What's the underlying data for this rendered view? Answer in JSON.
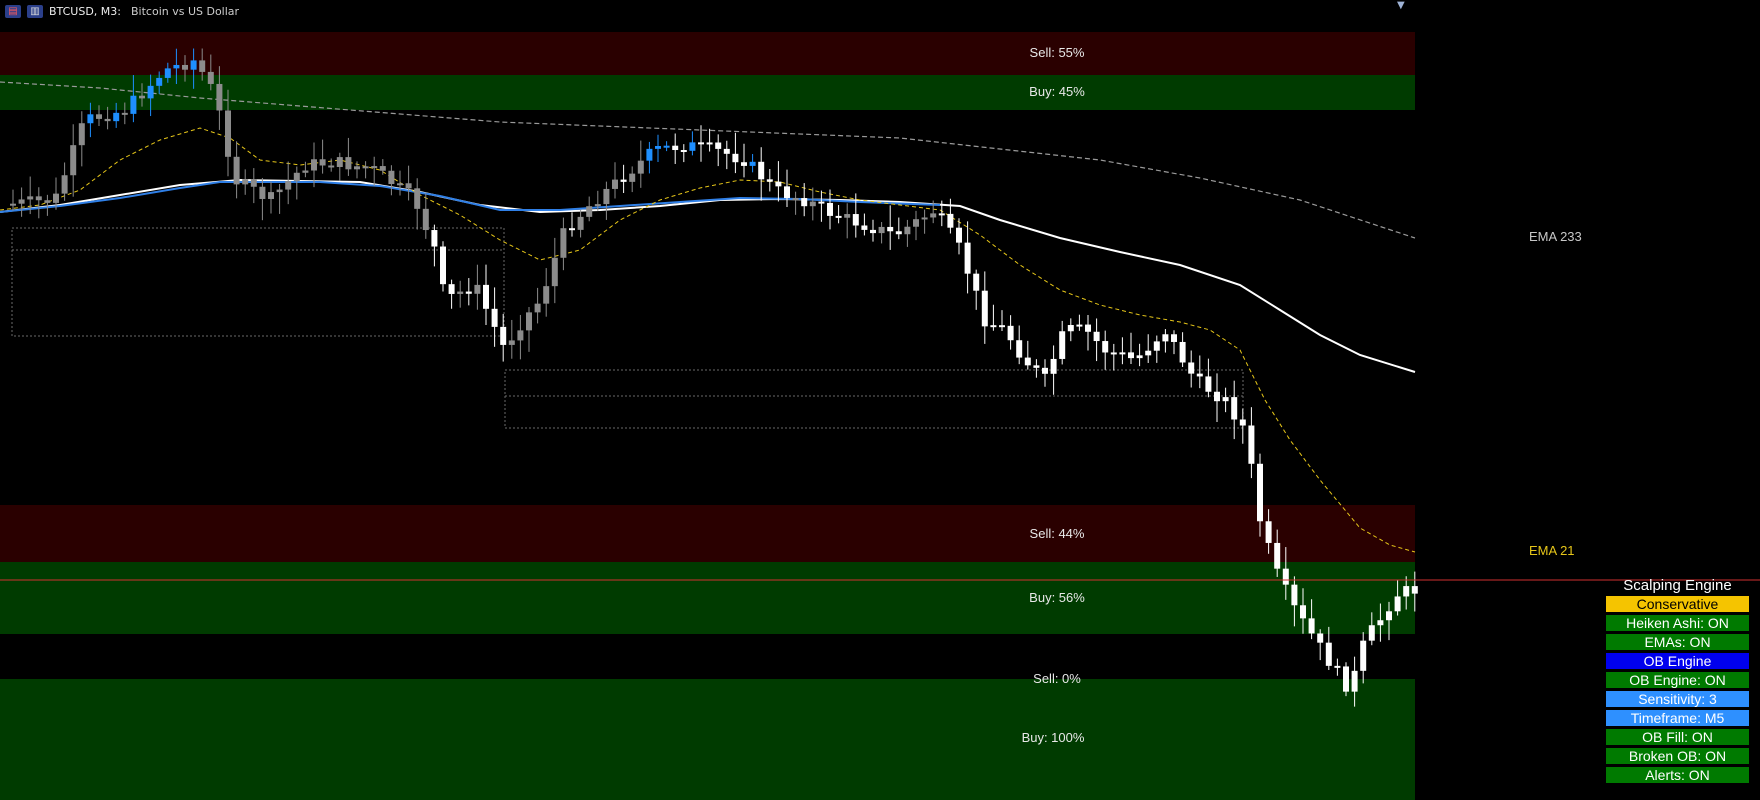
{
  "window": {
    "symbol": "BTCUSD, M3:",
    "description": "Bitcoin vs US Dollar"
  },
  "zones": [
    {
      "top": {
        "label": "Sell: 55%"
      },
      "bottom": {
        "label": "Buy: 45%"
      }
    },
    {
      "top": {
        "label": "Sell: 44%"
      },
      "bottom": {
        "label": "Buy: 56%"
      }
    },
    {
      "top": {
        "label": "Sell: 0%"
      },
      "bottom": {
        "label": "Buy: 100%"
      }
    }
  ],
  "ema_labels": {
    "slow": {
      "text": "EMA 233",
      "color": "#c8c8c8"
    },
    "fast": {
      "text": "EMA 21",
      "color": "#e6c619"
    }
  },
  "colors": {
    "sell_zone": "#2a0000",
    "buy_zone": "#003b00",
    "bull_candle": "#1e8fff",
    "bear_candle": "#ffffff",
    "neutral_candle": "#8c8c8c",
    "ema21": "#e6c619",
    "ema_white": "#ffffff",
    "ema_blue": "#2f7fe6",
    "ema233": "#9a9a9a",
    "price_line": "#d03030"
  },
  "panel": {
    "title": "Scalping Engine",
    "rows": [
      {
        "label": "Conservative",
        "bg": "#f5c400",
        "color": "#000000"
      },
      {
        "label": "Heiken Ashi: ON",
        "bg": "#007a00",
        "color": "#ffffff"
      },
      {
        "label": "EMAs: ON",
        "bg": "#007a00",
        "color": "#ffffff"
      },
      {
        "label": "OB Engine",
        "bg": "#0000ee",
        "color": "#ffffff"
      },
      {
        "label": "OB Engine: ON",
        "bg": "#007a00",
        "color": "#ffffff"
      },
      {
        "label": "Sensitivity: 3",
        "bg": "#2e90ff",
        "color": "#ffffff"
      },
      {
        "label": "Timeframe: M5",
        "bg": "#2e90ff",
        "color": "#ffffff"
      },
      {
        "label": "OB Fill: ON",
        "bg": "#007a00",
        "color": "#ffffff"
      },
      {
        "label": "Broken OB: ON",
        "bg": "#007a00",
        "color": "#ffffff"
      },
      {
        "label": "Alerts: ON",
        "bg": "#007a00",
        "color": "#ffffff"
      }
    ]
  }
}
